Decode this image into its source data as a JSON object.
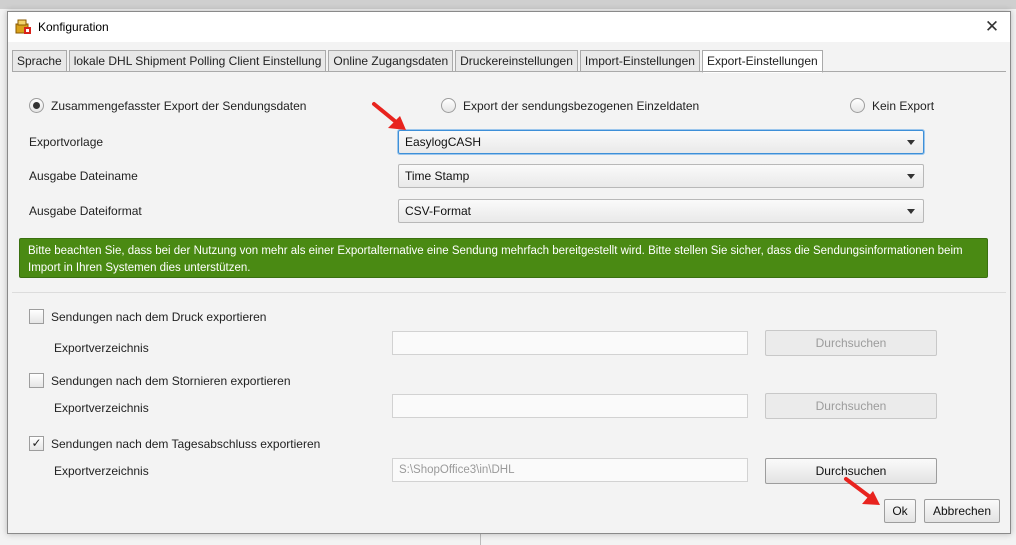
{
  "window": {
    "title": "Konfiguration",
    "close_glyph": "✕"
  },
  "tabs": [
    {
      "label": "Sprache",
      "active": false
    },
    {
      "label": "lokale DHL Shipment Polling Client Einstellung",
      "active": false
    },
    {
      "label": "Online Zugangsdaten",
      "active": false
    },
    {
      "label": "Druckereinstellungen",
      "active": false
    },
    {
      "label": "Import-Einstellungen",
      "active": false
    },
    {
      "label": "Export-Einstellungen",
      "active": true
    }
  ],
  "export_mode": {
    "options": [
      {
        "label": "Zusammengefasster Export der Sendungsdaten",
        "selected": true
      },
      {
        "label": "Export der sendungsbezogenen Einzeldaten",
        "selected": false
      },
      {
        "label": "Kein Export",
        "selected": false
      }
    ]
  },
  "fields": {
    "template": {
      "label": "Exportvorlage",
      "value": "EasylogCASH"
    },
    "filename": {
      "label": "Ausgabe Dateiname",
      "value": "Time Stamp"
    },
    "fileformat": {
      "label": "Ausgabe Dateiformat",
      "value": "CSV-Format"
    }
  },
  "notice": {
    "text": "Bitte beachten Sie, dass bei der Nutzung von mehr als einer Exportalternative eine Sendung mehrfach bereitgestellt wird. Bitte stellen Sie sicher, dass die Sendungsinformationen beim Import in Ihren Systemen dies unterstützen.",
    "color": "#4a8a13"
  },
  "export_options": [
    {
      "label": "Sendungen nach dem Druck exportieren",
      "checked": false,
      "dir_label": "Exportverzeichnis",
      "path": "",
      "browse": "Durchsuchen"
    },
    {
      "label": "Sendungen nach dem Stornieren exportieren",
      "checked": false,
      "dir_label": "Exportverzeichnis",
      "path": "",
      "browse": "Durchsuchen"
    },
    {
      "label": "Sendungen nach dem Tagesabschluss exportieren",
      "checked": true,
      "dir_label": "Exportverzeichnis",
      "path": "S:\\ShopOffice3\\in\\DHL",
      "browse": "Durchsuchen"
    }
  ],
  "footer": {
    "ok_label": "Ok",
    "cancel_label": "Abbrechen"
  },
  "annotations": {
    "arrow_color": "#e8231e"
  }
}
